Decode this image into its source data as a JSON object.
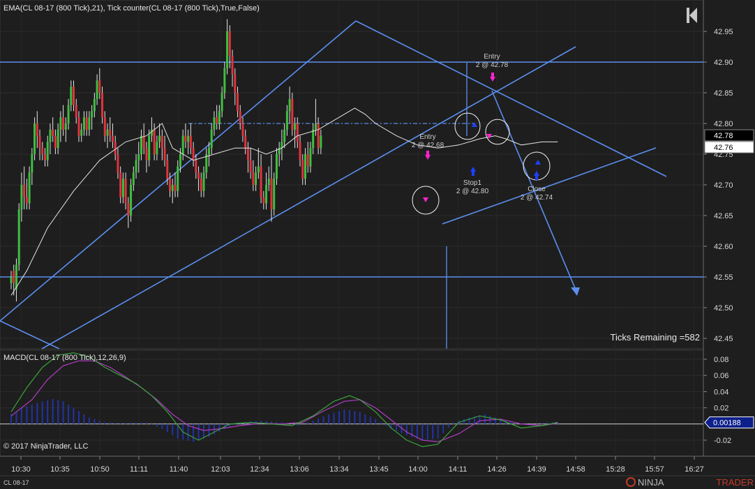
{
  "header": {
    "title": "EMA(CL 08-17 (800 Tick),21), Tick counter(CL 08-17 (800 Tick),True,False)",
    "macd_title": "MACD(CL 08-17 (800 Tick),12,26,9)",
    "copyright": "© 2017 NinjaTrader, LLC",
    "instrument_tab": "CL 08-17",
    "brand_left": "NINJA",
    "brand_right": "TRADER",
    "ticks_remaining": "Ticks Remaining =582"
  },
  "colors": {
    "background": "#1e1e1e",
    "up_candle": "#3fbf3f",
    "down_candle": "#e0343f",
    "drawing": "#5b8ff0",
    "ema": "#e6e6e6",
    "macd": "#3aa43a",
    "signal": "#b43cc8",
    "histogram": "#2233a8",
    "buy_marker": "#1f3fff",
    "sell_marker": "#ff22d0"
  },
  "chart_data": [
    {
      "type": "candlestick",
      "y_axis": {
        "ylim": [
          42.43,
          42.97
        ],
        "ticks": [
          "42.95",
          "42.90",
          "42.85",
          "42.80",
          "42.75",
          "42.70",
          "42.65",
          "42.60",
          "42.55",
          "42.50",
          "42.45"
        ]
      },
      "x_axis": {
        "ticks": [
          "10:30",
          "10:35",
          "10:50",
          "11:11",
          "11:40",
          "12:03",
          "12:34",
          "13:06",
          "13:34",
          "13:45",
          "14:00",
          "14:11",
          "14:26",
          "14:39",
          "14:58",
          "15:28",
          "15:57",
          "16:27"
        ]
      },
      "price_labels": [
        "42.78",
        "42.76"
      ],
      "candles": [
        [
          42.54,
          42.56,
          42.53,
          42.55
        ],
        [
          42.56,
          42.57,
          42.52,
          42.54
        ],
        [
          42.53,
          42.58,
          42.51,
          42.57
        ],
        [
          42.57,
          42.67,
          42.56,
          42.66
        ],
        [
          42.66,
          42.72,
          42.64,
          42.7
        ],
        [
          42.7,
          42.73,
          42.66,
          42.68
        ],
        [
          42.68,
          42.71,
          42.66,
          42.67
        ],
        [
          42.67,
          42.73,
          42.66,
          42.72
        ],
        [
          42.72,
          42.76,
          42.7,
          42.75
        ],
        [
          42.75,
          42.81,
          42.74,
          42.8
        ],
        [
          42.8,
          42.82,
          42.76,
          42.78
        ],
        [
          42.78,
          42.79,
          42.74,
          42.76
        ],
        [
          42.76,
          42.77,
          42.74,
          42.75
        ],
        [
          42.75,
          42.76,
          42.73,
          42.74
        ],
        [
          42.74,
          42.78,
          42.73,
          42.77
        ],
        [
          42.77,
          42.8,
          42.75,
          42.79
        ],
        [
          42.79,
          42.81,
          42.77,
          42.78
        ],
        [
          42.78,
          42.79,
          42.75,
          42.76
        ],
        [
          42.76,
          42.8,
          42.75,
          42.79
        ],
        [
          42.79,
          42.82,
          42.77,
          42.81
        ],
        [
          42.81,
          42.83,
          42.78,
          42.79
        ],
        [
          42.79,
          42.81,
          42.77,
          42.8
        ],
        [
          42.8,
          42.84,
          42.79,
          42.83
        ],
        [
          42.83,
          42.87,
          42.82,
          42.86
        ],
        [
          42.86,
          42.87,
          42.82,
          42.83
        ],
        [
          42.83,
          42.84,
          42.8,
          42.81
        ],
        [
          42.81,
          42.82,
          42.77,
          42.78
        ],
        [
          42.78,
          42.8,
          42.77,
          42.79
        ],
        [
          42.79,
          42.82,
          42.78,
          42.81
        ],
        [
          42.81,
          42.82,
          42.78,
          42.79
        ],
        [
          42.79,
          42.82,
          42.78,
          42.81
        ],
        [
          42.81,
          42.83,
          42.79,
          42.82
        ],
        [
          42.82,
          42.85,
          42.81,
          42.84
        ],
        [
          42.84,
          42.88,
          42.83,
          42.87
        ],
        [
          42.87,
          42.89,
          42.84,
          42.85
        ],
        [
          42.85,
          42.86,
          42.8,
          42.81
        ],
        [
          42.81,
          42.82,
          42.77,
          42.78
        ],
        [
          42.78,
          42.8,
          42.76,
          42.79
        ],
        [
          42.79,
          42.81,
          42.77,
          42.78
        ],
        [
          42.78,
          42.8,
          42.76,
          42.77
        ],
        [
          42.77,
          42.78,
          42.74,
          42.75
        ],
        [
          42.75,
          42.76,
          42.71,
          42.72
        ],
        [
          42.72,
          42.73,
          42.67,
          42.68
        ],
        [
          42.68,
          42.72,
          42.67,
          42.71
        ],
        [
          42.71,
          42.72,
          42.66,
          42.67
        ],
        [
          42.67,
          42.68,
          42.63,
          42.65
        ],
        [
          42.65,
          42.71,
          42.64,
          42.7
        ],
        [
          42.7,
          42.73,
          42.69,
          42.72
        ],
        [
          42.72,
          42.75,
          42.71,
          42.74
        ],
        [
          42.74,
          42.77,
          42.72,
          42.75
        ],
        [
          42.75,
          42.79,
          42.74,
          42.78
        ],
        [
          42.78,
          42.8,
          42.75,
          42.76
        ],
        [
          42.76,
          42.77,
          42.72,
          42.74
        ],
        [
          42.74,
          42.79,
          42.73,
          42.78
        ],
        [
          42.78,
          42.81,
          42.77,
          42.79
        ],
        [
          42.79,
          42.8,
          42.74,
          42.75
        ],
        [
          42.75,
          42.78,
          42.74,
          42.77
        ],
        [
          42.77,
          42.8,
          42.76,
          42.78
        ],
        [
          42.78,
          42.79,
          42.74,
          42.76
        ],
        [
          42.76,
          42.78,
          42.73,
          42.74
        ],
        [
          42.74,
          42.75,
          42.7,
          42.71
        ],
        [
          42.71,
          42.72,
          42.68,
          42.69
        ],
        [
          42.69,
          42.71,
          42.67,
          42.7
        ],
        [
          42.7,
          42.72,
          42.68,
          42.69
        ],
        [
          42.69,
          42.74,
          42.68,
          42.73
        ],
        [
          42.73,
          42.76,
          42.72,
          42.75
        ],
        [
          42.75,
          42.79,
          42.74,
          42.78
        ],
        [
          42.78,
          42.8,
          42.76,
          42.77
        ],
        [
          42.77,
          42.79,
          42.75,
          42.78
        ],
        [
          42.78,
          42.8,
          42.75,
          42.76
        ],
        [
          42.76,
          42.77,
          42.73,
          42.74
        ],
        [
          42.74,
          42.75,
          42.71,
          42.72
        ],
        [
          42.72,
          42.73,
          42.69,
          42.71
        ],
        [
          42.71,
          42.72,
          42.68,
          42.69
        ],
        [
          42.69,
          42.73,
          42.68,
          42.72
        ],
        [
          42.72,
          42.76,
          42.71,
          42.75
        ],
        [
          42.75,
          42.77,
          42.73,
          42.76
        ],
        [
          42.76,
          42.8,
          42.75,
          42.79
        ],
        [
          42.79,
          42.82,
          42.78,
          42.81
        ],
        [
          42.81,
          42.83,
          42.79,
          42.8
        ],
        [
          42.8,
          42.83,
          42.79,
          42.82
        ],
        [
          42.82,
          42.86,
          42.81,
          42.85
        ],
        [
          42.85,
          42.9,
          42.84,
          42.89
        ],
        [
          42.89,
          42.97,
          42.88,
          42.95
        ],
        [
          42.95,
          42.96,
          42.89,
          42.91
        ],
        [
          42.91,
          42.92,
          42.86,
          42.88
        ],
        [
          42.88,
          42.89,
          42.83,
          42.85
        ],
        [
          42.85,
          42.86,
          42.81,
          42.82
        ],
        [
          42.82,
          42.83,
          42.79,
          42.8
        ],
        [
          42.8,
          42.81,
          42.77,
          42.78
        ],
        [
          42.78,
          42.79,
          42.75,
          42.76
        ],
        [
          42.76,
          42.77,
          42.72,
          42.74
        ],
        [
          42.74,
          42.76,
          42.71,
          42.72
        ],
        [
          42.72,
          42.74,
          42.69,
          42.7
        ],
        [
          42.7,
          42.73,
          42.69,
          42.72
        ],
        [
          42.72,
          42.76,
          42.71,
          42.73
        ],
        [
          42.73,
          42.75,
          42.67,
          42.68
        ],
        [
          42.68,
          42.69,
          42.66,
          42.67
        ],
        [
          42.67,
          42.72,
          42.66,
          42.7
        ],
        [
          42.7,
          42.73,
          42.69,
          42.71
        ],
        [
          42.71,
          42.75,
          42.64,
          42.66
        ],
        [
          42.66,
          42.72,
          42.65,
          42.71
        ],
        [
          42.71,
          42.76,
          42.7,
          42.75
        ],
        [
          42.75,
          42.77,
          42.73,
          42.76
        ],
        [
          42.76,
          42.79,
          42.74,
          42.77
        ],
        [
          42.77,
          42.8,
          42.76,
          42.79
        ],
        [
          42.79,
          42.83,
          42.78,
          42.82
        ],
        [
          42.82,
          42.86,
          42.8,
          42.84
        ],
        [
          42.84,
          42.85,
          42.78,
          42.79
        ],
        [
          42.79,
          42.81,
          42.76,
          42.8
        ],
        [
          42.8,
          42.81,
          42.76,
          42.77
        ],
        [
          42.77,
          42.78,
          42.73,
          42.74
        ],
        [
          42.74,
          42.75,
          42.7,
          42.71
        ],
        [
          42.71,
          42.76,
          42.7,
          42.75
        ],
        [
          42.75,
          42.77,
          42.72,
          42.73
        ],
        [
          42.73,
          42.77,
          42.72,
          42.76
        ],
        [
          42.76,
          42.8,
          42.75,
          42.79
        ],
        [
          42.79,
          42.84,
          42.78,
          42.8
        ],
        [
          42.8,
          42.81,
          42.75,
          42.76
        ],
        [
          42.76,
          42.79,
          42.75,
          42.78
        ]
      ],
      "ema": [
        [
          0,
          42.52
        ],
        [
          6,
          42.56
        ],
        [
          14,
          42.63
        ],
        [
          24,
          42.69
        ],
        [
          34,
          42.74
        ],
        [
          44,
          42.77
        ],
        [
          52,
          42.78
        ],
        [
          58,
          42.8
        ],
        [
          62,
          42.76
        ],
        [
          70,
          42.74
        ],
        [
          78,
          42.75
        ],
        [
          86,
          42.76
        ],
        [
          92,
          42.76
        ],
        [
          98,
          42.75
        ],
        [
          104,
          42.76
        ],
        [
          110,
          42.78
        ],
        [
          118,
          42.79
        ],
        [
          126,
          42.81
        ],
        [
          132,
          42.825
        ],
        [
          136,
          42.815
        ],
        [
          140,
          42.8
        ],
        [
          148,
          42.78
        ],
        [
          156,
          42.765
        ],
        [
          164,
          42.76
        ],
        [
          172,
          42.765
        ],
        [
          180,
          42.775
        ],
        [
          186,
          42.78
        ],
        [
          190,
          42.775
        ],
        [
          196,
          42.765
        ],
        [
          204,
          42.77
        ],
        [
          210,
          42.77
        ]
      ],
      "annotations": [
        {
          "label": "Entry",
          "value": "2 @ 42.78"
        },
        {
          "label": "Entry",
          "value": "2 @ 42.68"
        },
        {
          "label": "Stop1",
          "value": "2 @ 42.80"
        },
        {
          "label": "Close",
          "value": "2 @ 42.74"
        }
      ],
      "horizontal_lines": [
        42.9,
        42.55
      ],
      "dashed_line": 42.8
    },
    {
      "type": "macd",
      "y_axis": {
        "ylim": [
          -0.034,
          0.092
        ],
        "ticks": [
          "0.08",
          "0.06",
          "0.04",
          "0.02",
          "-0.02"
        ]
      },
      "value_label": "0.00188",
      "histogram": [
        [
          1,
          0.012
        ],
        [
          4,
          0.02
        ],
        [
          10,
          0.026
        ],
        [
          16,
          0.031
        ],
        [
          20,
          0.028
        ],
        [
          24,
          0.02
        ],
        [
          30,
          0.008
        ],
        [
          36,
          0.002
        ],
        [
          44,
          0.001
        ],
        [
          52,
          0.002
        ],
        [
          58,
          -0.006
        ],
        [
          64,
          -0.018
        ],
        [
          70,
          -0.022
        ],
        [
          76,
          -0.016
        ],
        [
          82,
          -0.006
        ],
        [
          88,
          0.002
        ],
        [
          96,
          0.004
        ],
        [
          104,
          0.002
        ],
        [
          110,
          -0.002
        ],
        [
          116,
          0.004
        ],
        [
          122,
          0.012
        ],
        [
          128,
          0.018
        ],
        [
          134,
          0.015
        ],
        [
          140,
          0.006
        ],
        [
          146,
          -0.006
        ],
        [
          152,
          -0.014
        ],
        [
          158,
          -0.02
        ],
        [
          164,
          -0.018
        ],
        [
          170,
          0.002
        ],
        [
          176,
          0.008
        ],
        [
          182,
          0.012
        ],
        [
          188,
          0.006
        ],
        [
          194,
          0.002
        ],
        [
          200,
          -0.002
        ],
        [
          205,
          0.002
        ],
        [
          210,
          0.0019
        ]
      ],
      "macd_line": [
        [
          0,
          0.015
        ],
        [
          6,
          0.045
        ],
        [
          12,
          0.07
        ],
        [
          18,
          0.085
        ],
        [
          24,
          0.088
        ],
        [
          30,
          0.083
        ],
        [
          36,
          0.07
        ],
        [
          42,
          0.06
        ],
        [
          48,
          0.05
        ],
        [
          54,
          0.035
        ],
        [
          60,
          0.015
        ],
        [
          66,
          -0.01
        ],
        [
          72,
          -0.02
        ],
        [
          78,
          -0.01
        ],
        [
          84,
          0.0
        ],
        [
          92,
          0.002
        ],
        [
          100,
          0.0
        ],
        [
          108,
          -0.002
        ],
        [
          116,
          0.01
        ],
        [
          124,
          0.028
        ],
        [
          130,
          0.035
        ],
        [
          134,
          0.03
        ],
        [
          140,
          0.015
        ],
        [
          146,
          -0.005
        ],
        [
          152,
          -0.02
        ],
        [
          158,
          -0.028
        ],
        [
          164,
          -0.025
        ],
        [
          172,
          0.002
        ],
        [
          180,
          0.01
        ],
        [
          188,
          0.005
        ],
        [
          196,
          -0.005
        ],
        [
          204,
          -0.002
        ],
        [
          210,
          0.002
        ]
      ],
      "signal_line": [
        [
          0,
          0.01
        ],
        [
          8,
          0.03
        ],
        [
          14,
          0.055
        ],
        [
          20,
          0.072
        ],
        [
          26,
          0.078
        ],
        [
          32,
          0.078
        ],
        [
          38,
          0.07
        ],
        [
          44,
          0.058
        ],
        [
          50,
          0.045
        ],
        [
          56,
          0.03
        ],
        [
          62,
          0.012
        ],
        [
          68,
          -0.002
        ],
        [
          74,
          -0.008
        ],
        [
          80,
          -0.006
        ],
        [
          88,
          -0.002
        ],
        [
          96,
          0.001
        ],
        [
          104,
          0.0
        ],
        [
          112,
          0.002
        ],
        [
          120,
          0.016
        ],
        [
          128,
          0.028
        ],
        [
          134,
          0.03
        ],
        [
          140,
          0.02
        ],
        [
          146,
          0.005
        ],
        [
          152,
          -0.01
        ],
        [
          158,
          -0.02
        ],
        [
          164,
          -0.022
        ],
        [
          172,
          -0.012
        ],
        [
          180,
          0.004
        ],
        [
          188,
          0.006
        ],
        [
          196,
          0.0
        ],
        [
          204,
          -0.002
        ],
        [
          210,
          0.001
        ]
      ]
    }
  ]
}
